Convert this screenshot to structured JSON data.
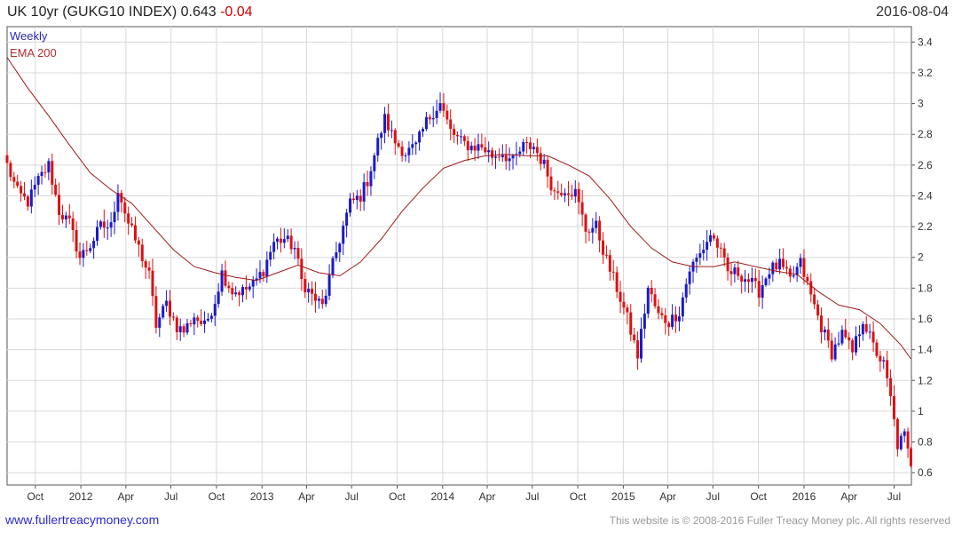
{
  "header": {
    "title_main": "UK 10yr (GUKG10 INDEX) 0.643",
    "title_change": "-0.04",
    "date": "2016-08-04"
  },
  "legend": {
    "weekly": "Weekly",
    "ema": "EMA 200"
  },
  "footer": {
    "link": "www.fullertreacymoney.com",
    "copyright": "This website is © 2008-2016 Fuller Treacy Money plc. All rights reserved"
  },
  "colors": {
    "up": "#1a1acc",
    "down": "#dd1111",
    "ema": "#a01818",
    "grid": "#d8d8d8",
    "axis": "#555555"
  },
  "chart_data": {
    "type": "candlestick",
    "frequency": "weekly",
    "x_tick_labels": [
      "Oct",
      "2012",
      "Apr",
      "Jul",
      "Oct",
      "2013",
      "Apr",
      "Jul",
      "Oct",
      "2014",
      "Apr",
      "Jul",
      "Oct",
      "2015",
      "Apr",
      "Jul",
      "Oct",
      "2016",
      "Apr",
      "Jul"
    ],
    "x_ticks": [
      "2011-10-01",
      "2012-01-01",
      "2012-04-01",
      "2012-07-01",
      "2012-10-01",
      "2013-01-01",
      "2013-04-01",
      "2013-07-01",
      "2013-10-01",
      "2014-01-01",
      "2014-04-01",
      "2014-07-01",
      "2014-10-01",
      "2015-01-01",
      "2015-04-01",
      "2015-07-01",
      "2015-10-01",
      "2016-01-01",
      "2016-04-01",
      "2016-07-01"
    ],
    "x_range": [
      "2011-08-05",
      "2016-08-05"
    ],
    "y_ticks": [
      "0.6",
      "0.8",
      "1",
      "1.2",
      "1.4",
      "1.6",
      "1.8",
      "2",
      "2.2",
      "2.4",
      "2.6",
      "2.8",
      "3",
      "3.2",
      "3.4"
    ],
    "ylim": [
      0.52,
      3.5
    ],
    "grid": true,
    "legend_position": "top-left",
    "close_series": [
      [
        "2011-08-05",
        2.6
      ],
      [
        "2011-08-26",
        2.42
      ],
      [
        "2011-09-16",
        2.36
      ],
      [
        "2011-10-07",
        2.5
      ],
      [
        "2011-10-28",
        2.6
      ],
      [
        "2011-11-18",
        2.3
      ],
      [
        "2011-12-09",
        2.22
      ],
      [
        "2011-12-30",
        2.0
      ],
      [
        "2012-01-20",
        2.08
      ],
      [
        "2012-02-10",
        2.2
      ],
      [
        "2012-03-02",
        2.2
      ],
      [
        "2012-03-16",
        2.45
      ],
      [
        "2012-04-06",
        2.22
      ],
      [
        "2012-04-27",
        2.06
      ],
      [
        "2012-05-18",
        1.88
      ],
      [
        "2012-06-01",
        1.56
      ],
      [
        "2012-06-22",
        1.7
      ],
      [
        "2012-07-13",
        1.55
      ],
      [
        "2012-07-27",
        1.52
      ],
      [
        "2012-08-17",
        1.62
      ],
      [
        "2012-09-07",
        1.55
      ],
      [
        "2012-09-28",
        1.72
      ],
      [
        "2012-10-12",
        1.9
      ],
      [
        "2012-11-02",
        1.78
      ],
      [
        "2012-11-23",
        1.78
      ],
      [
        "2012-12-14",
        1.82
      ],
      [
        "2013-01-04",
        1.92
      ],
      [
        "2013-01-25",
        2.1
      ],
      [
        "2013-02-15",
        2.12
      ],
      [
        "2013-03-08",
        2.06
      ],
      [
        "2013-03-22",
        1.85
      ],
      [
        "2013-04-12",
        1.75
      ],
      [
        "2013-05-03",
        1.68
      ],
      [
        "2013-05-24",
        1.95
      ],
      [
        "2013-06-14",
        2.2
      ],
      [
        "2013-06-28",
        2.35
      ],
      [
        "2013-07-19",
        2.4
      ],
      [
        "2013-08-02",
        2.5
      ],
      [
        "2013-08-23",
        2.75
      ],
      [
        "2013-09-06",
        2.9
      ],
      [
        "2013-09-27",
        2.75
      ],
      [
        "2013-10-18",
        2.68
      ],
      [
        "2013-11-08",
        2.72
      ],
      [
        "2013-11-29",
        2.88
      ],
      [
        "2013-12-13",
        2.95
      ],
      [
        "2013-12-27",
        3.0
      ],
      [
        "2014-01-17",
        2.82
      ],
      [
        "2014-02-07",
        2.75
      ],
      [
        "2014-02-28",
        2.72
      ],
      [
        "2014-03-21",
        2.72
      ],
      [
        "2014-04-11",
        2.66
      ],
      [
        "2014-05-02",
        2.68
      ],
      [
        "2014-05-23",
        2.62
      ],
      [
        "2014-06-13",
        2.72
      ],
      [
        "2014-07-04",
        2.72
      ],
      [
        "2014-07-25",
        2.6
      ],
      [
        "2014-08-15",
        2.42
      ],
      [
        "2014-09-05",
        2.45
      ],
      [
        "2014-09-26",
        2.42
      ],
      [
        "2014-10-17",
        2.18
      ],
      [
        "2014-11-07",
        2.2
      ],
      [
        "2014-11-28",
        1.98
      ],
      [
        "2014-12-19",
        1.8
      ],
      [
        "2015-01-09",
        1.6
      ],
      [
        "2015-01-30",
        1.36
      ],
      [
        "2015-02-20",
        1.8
      ],
      [
        "2015-03-13",
        1.62
      ],
      [
        "2015-04-03",
        1.58
      ],
      [
        "2015-04-24",
        1.65
      ],
      [
        "2015-05-15",
        1.92
      ],
      [
        "2015-06-05",
        2.02
      ],
      [
        "2015-06-26",
        2.15
      ],
      [
        "2015-07-10",
        2.08
      ],
      [
        "2015-07-31",
        1.9
      ],
      [
        "2015-08-21",
        1.9
      ],
      [
        "2015-09-11",
        1.85
      ],
      [
        "2015-10-02",
        1.78
      ],
      [
        "2015-10-23",
        1.92
      ],
      [
        "2015-11-13",
        1.95
      ],
      [
        "2015-12-04",
        1.85
      ],
      [
        "2015-12-25",
        1.96
      ],
      [
        "2016-01-15",
        1.75
      ],
      [
        "2016-02-05",
        1.55
      ],
      [
        "2016-02-26",
        1.38
      ],
      [
        "2016-03-18",
        1.5
      ],
      [
        "2016-04-08",
        1.38
      ],
      [
        "2016-04-29",
        1.6
      ],
      [
        "2016-05-20",
        1.42
      ],
      [
        "2016-06-10",
        1.3
      ],
      [
        "2016-06-24",
        1.08
      ],
      [
        "2016-07-08",
        0.78
      ],
      [
        "2016-07-22",
        0.84
      ],
      [
        "2016-08-04",
        0.643
      ]
    ],
    "ema_series": [
      [
        "2011-08-05",
        3.3
      ],
      [
        "2011-09-16",
        3.1
      ],
      [
        "2011-10-28",
        2.92
      ],
      [
        "2011-12-09",
        2.73
      ],
      [
        "2012-01-20",
        2.55
      ],
      [
        "2012-03-02",
        2.44
      ],
      [
        "2012-04-13",
        2.35
      ],
      [
        "2012-05-25",
        2.2
      ],
      [
        "2012-07-06",
        2.05
      ],
      [
        "2012-08-17",
        1.94
      ],
      [
        "2012-09-28",
        1.9
      ],
      [
        "2012-11-09",
        1.87
      ],
      [
        "2012-12-21",
        1.85
      ],
      [
        "2013-02-01",
        1.9
      ],
      [
        "2013-03-15",
        1.95
      ],
      [
        "2013-04-26",
        1.9
      ],
      [
        "2013-06-07",
        1.88
      ],
      [
        "2013-07-19",
        1.97
      ],
      [
        "2013-08-30",
        2.12
      ],
      [
        "2013-10-11",
        2.3
      ],
      [
        "2013-11-22",
        2.45
      ],
      [
        "2014-01-03",
        2.58
      ],
      [
        "2014-02-14",
        2.63
      ],
      [
        "2014-03-28",
        2.66
      ],
      [
        "2014-05-09",
        2.67
      ],
      [
        "2014-06-20",
        2.66
      ],
      [
        "2014-08-01",
        2.66
      ],
      [
        "2014-09-12",
        2.6
      ],
      [
        "2014-10-24",
        2.53
      ],
      [
        "2014-12-05",
        2.38
      ],
      [
        "2015-01-16",
        2.2
      ],
      [
        "2015-02-27",
        2.06
      ],
      [
        "2015-04-10",
        1.97
      ],
      [
        "2015-05-22",
        1.94
      ],
      [
        "2015-07-03",
        1.94
      ],
      [
        "2015-08-14",
        1.97
      ],
      [
        "2015-09-25",
        1.94
      ],
      [
        "2015-11-06",
        1.91
      ],
      [
        "2015-12-18",
        1.89
      ],
      [
        "2016-01-29",
        1.78
      ],
      [
        "2016-03-11",
        1.69
      ],
      [
        "2016-04-22",
        1.66
      ],
      [
        "2016-06-03",
        1.57
      ],
      [
        "2016-07-15",
        1.43
      ],
      [
        "2016-08-04",
        1.34
      ]
    ],
    "last_close": 0.643,
    "last_change": -0.04
  }
}
